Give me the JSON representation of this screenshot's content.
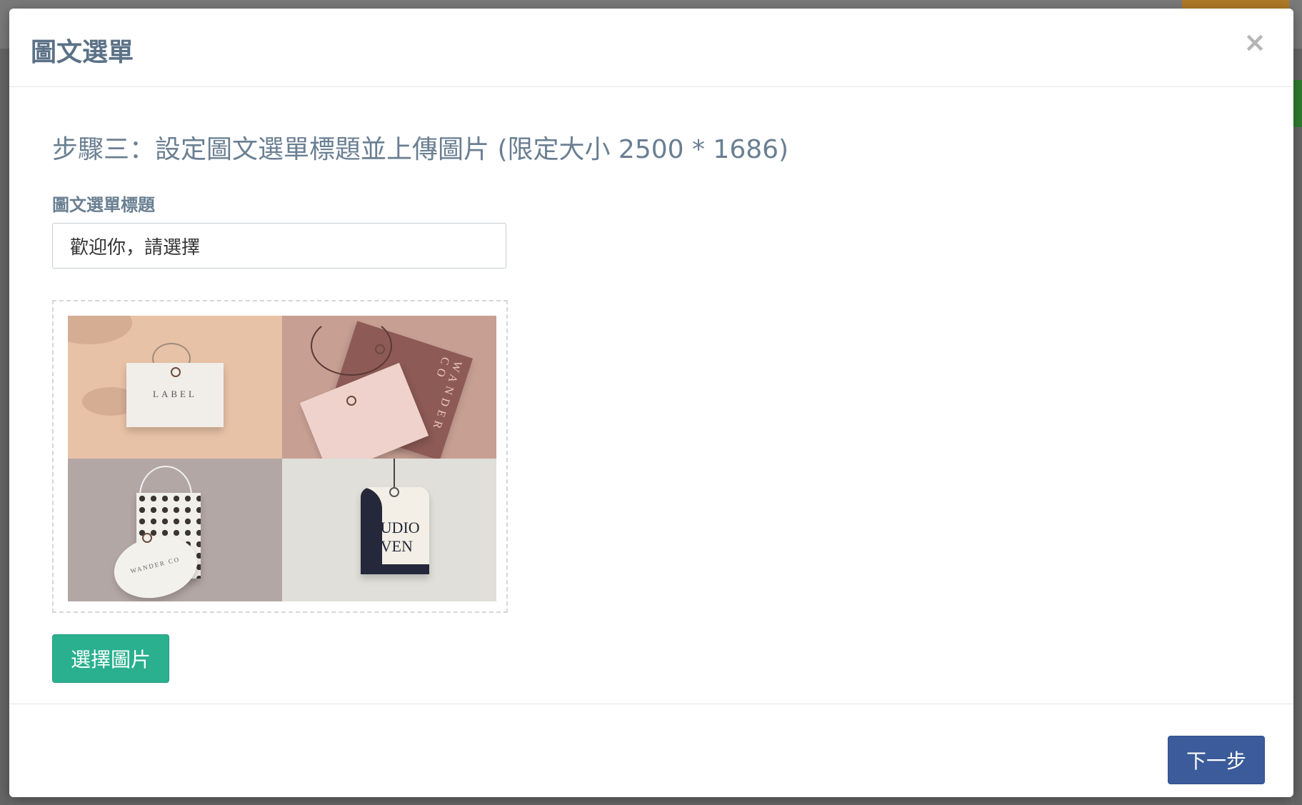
{
  "modal": {
    "title": "圖文選單",
    "close_label": "×"
  },
  "step": {
    "heading": "步驟三：設定圖文選單標題並上傳圖片 (限定大小 2500 * 1686)"
  },
  "form": {
    "title_label": "圖文選單標題",
    "title_value": "歡迎你，請選擇"
  },
  "preview": {
    "tiles": [
      {
        "text": "LABEL"
      },
      {
        "text": "WANDER CO"
      },
      {
        "text": "WANDER CO"
      },
      {
        "text": "STUDIO SEVEN"
      }
    ]
  },
  "buttons": {
    "choose_image": "選擇圖片",
    "next": "下一步"
  },
  "colors": {
    "primary": "#3b5b9a",
    "success": "#2ab08f",
    "heading": "#6a7f92"
  }
}
